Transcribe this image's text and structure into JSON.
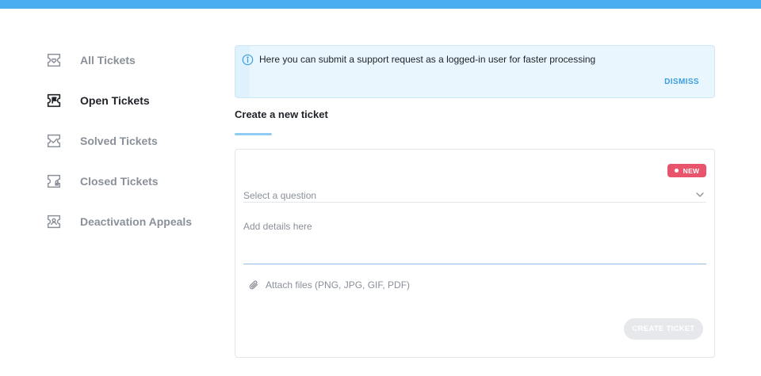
{
  "colors": {
    "topbar": "#4aaeef",
    "accent": "#3a9fe0",
    "badge": "#e8546b",
    "muted_text": "#8a9099",
    "text": "#1f2328"
  },
  "sidebar": {
    "items": [
      {
        "label": "All Tickets",
        "icon": "ticket-heart-icon",
        "active": false
      },
      {
        "label": "Open Tickets",
        "icon": "ticket-flag-icon",
        "active": true
      },
      {
        "label": "Solved Tickets",
        "icon": "ticket-check-icon",
        "active": false
      },
      {
        "label": "Closed Tickets",
        "icon": "ticket-lock-icon",
        "active": false
      },
      {
        "label": "Deactivation Appeals",
        "icon": "ticket-person-icon",
        "active": false
      }
    ]
  },
  "banner": {
    "icon": "info-icon",
    "message": "Here you can submit a support request as a logged-in user for faster processing",
    "dismiss_label": "DISMISS"
  },
  "form": {
    "title": "Create a new ticket",
    "badge_label": "NEW",
    "question_placeholder": "Select a question",
    "details_placeholder": "Add details here",
    "details_value": "",
    "attach_label": "Attach files (PNG, JPG, GIF, PDF)",
    "submit_label": "CREATE TICKET"
  }
}
